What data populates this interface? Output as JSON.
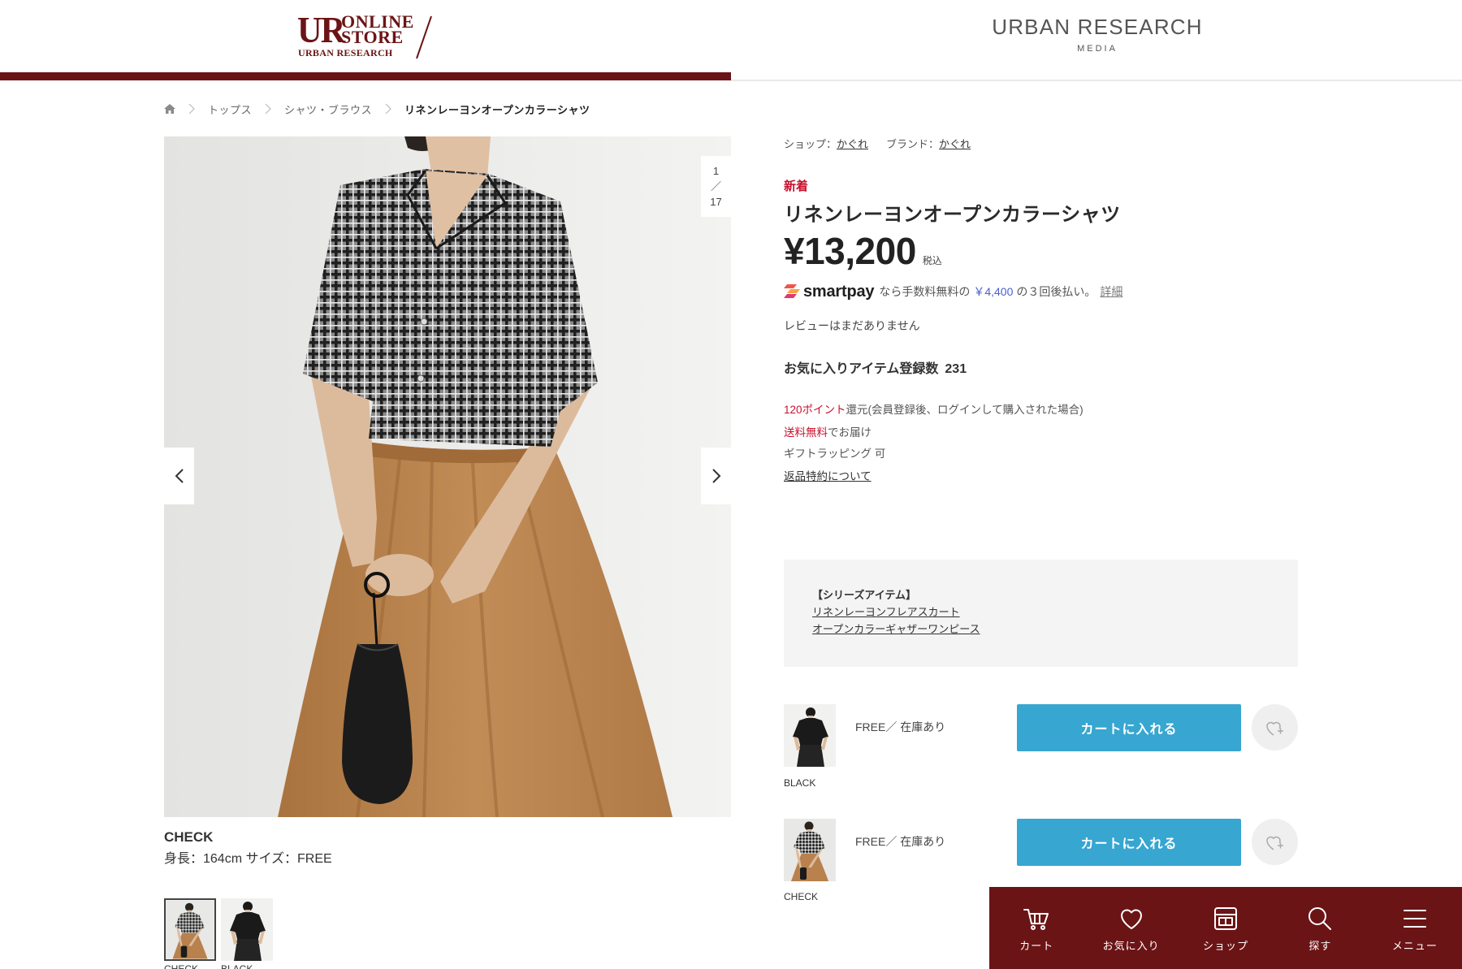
{
  "header": {
    "store_logo": {
      "mark": "UR",
      "line1": "ONLINE",
      "line2": "STORE",
      "line3": "URBAN RESEARCH"
    },
    "media_logo": {
      "title": "URBAN RESEARCH",
      "sub": "MEDIA"
    }
  },
  "breadcrumb": {
    "home_icon": "home-icon",
    "items": [
      "トップス",
      "シャツ・ブラウス",
      "リネンレーヨンオープンカラーシャツ"
    ]
  },
  "gallery": {
    "counter": {
      "current": "1",
      "separator": "／",
      "total": "17"
    },
    "prev_icon": "chevron-left-icon",
    "next_icon": "chevron-right-icon",
    "caption": {
      "color": "CHECK",
      "model_info": "身長：164cm サイズ：FREE"
    },
    "thumbnails": [
      {
        "label": "CHECK",
        "selected": true
      },
      {
        "label": "BLACK",
        "selected": false
      }
    ]
  },
  "product": {
    "shop_label": "ショップ：",
    "shop": "かぐれ",
    "brand_label": "ブランド：",
    "brand": "かぐれ",
    "badge": "新着",
    "title": "リネンレーヨンオープンカラーシャツ",
    "price": "¥13,200",
    "tax_note": "税込",
    "smartpay": {
      "logo": "smartpay",
      "text_before": "なら手数料無料の",
      "amount": "￥4,400",
      "text_after": "の３回後払い。",
      "detail_link": "詳細"
    },
    "review_status": "レビューはまだありません",
    "favorites": {
      "label": "お気に入りアイテム登録数",
      "count": "231"
    },
    "points": {
      "highlight": "120ポイント",
      "text": "還元(会員登録後、ログインして購入された場合)"
    },
    "shipping": {
      "highlight": "送料無料",
      "text": "でお届け"
    },
    "gift": "ギフトラッピング 可",
    "returns_link": "返品特約について"
  },
  "series": {
    "heading": "【シリーズアイテム】",
    "links": [
      "リネンレーヨンフレアスカート",
      "オープンカラーギャザーワンピース"
    ]
  },
  "skus": [
    {
      "color": "BLACK",
      "stock": "FREE／ 在庫あり",
      "button": "カートに入れる",
      "favorite_icon": "heart-plus-icon"
    },
    {
      "color": "CHECK",
      "stock": "FREE／ 在庫あり",
      "button": "カートに入れる",
      "favorite_icon": "heart-plus-icon"
    }
  ],
  "bottom_nav": {
    "items": [
      {
        "label": "カート",
        "icon": "cart-icon"
      },
      {
        "label": "お気に入り",
        "icon": "heart-icon"
      },
      {
        "label": "ショップ",
        "icon": "shop-icon"
      },
      {
        "label": "探す",
        "icon": "search-icon"
      },
      {
        "label": "メニュー",
        "icon": "menu-icon"
      }
    ]
  },
  "colors": {
    "brand": "#6b1416",
    "cart_button": "#37a6d1",
    "accent_red": "#c8102e",
    "smartpay_amount": "#4a5fd0",
    "series_box": "#f4f4f4"
  }
}
